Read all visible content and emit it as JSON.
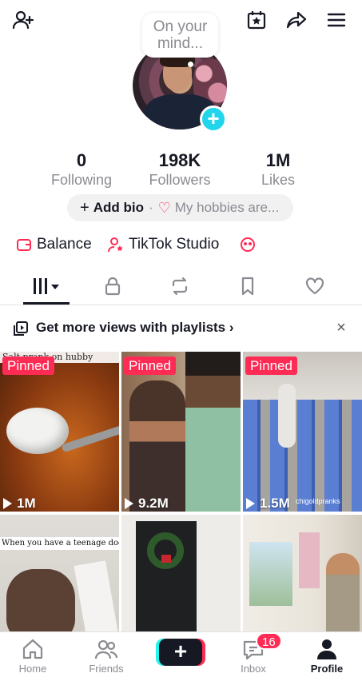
{
  "colors": {
    "accent": "#fe2c55",
    "avatar_plus": "#20d5ec",
    "text": "#161823",
    "muted": "#8a8b91"
  },
  "top_icons": [
    "add-friend-icon",
    "calendar-star-icon",
    "share-icon",
    "menu-icon"
  ],
  "status_bubble": {
    "text": "On your mind..."
  },
  "stats": [
    {
      "value": "0",
      "label": "Following"
    },
    {
      "value": "198K",
      "label": "Followers"
    },
    {
      "value": "1M",
      "label": "Likes"
    }
  ],
  "bio": {
    "add_label": "Add bio",
    "hobbies_label": "My hobbies are..."
  },
  "quick_links": {
    "balance": "Balance",
    "studio": "TikTok Studio"
  },
  "tabs": [
    "videos-grid-icon",
    "lock-icon",
    "repost-icon",
    "bookmark-icon",
    "heart-icon"
  ],
  "playlist_banner": {
    "text": "Get more views with playlists ›",
    "close": "×"
  },
  "videos": [
    {
      "pinned": "Pinned",
      "views": "1M",
      "caption": "Salt prank on hubby"
    },
    {
      "pinned": "Pinned",
      "views": "9.2M"
    },
    {
      "pinned": "Pinned",
      "views": "1.5M",
      "watermark": "chigoldpranks"
    },
    {
      "caption": "When you have a teenage dog😂"
    },
    {},
    {}
  ],
  "pinned_label": "Pinned",
  "bottom_nav": {
    "home": "Home",
    "friends": "Friends",
    "create": "+",
    "inbox": "Inbox",
    "inbox_badge": "16",
    "profile": "Profile"
  }
}
